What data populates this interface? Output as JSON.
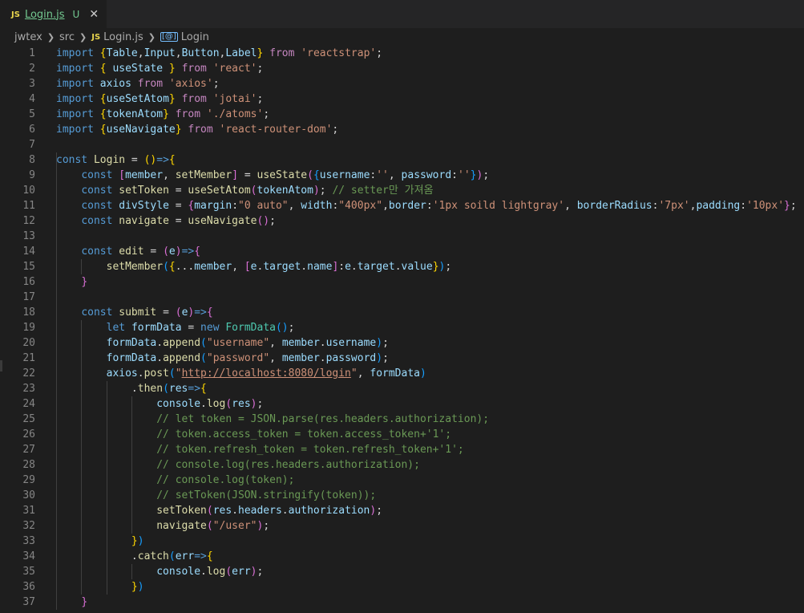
{
  "tab": {
    "badge": "JS",
    "filename": "Login.js",
    "status": "U",
    "close": "✕"
  },
  "breadcrumb": {
    "root": "jwtex",
    "folder": "src",
    "file_badge": "JS",
    "file": "Login.js",
    "symbol_icon": "[@]",
    "symbol": "Login"
  },
  "editor": {
    "lines": [
      [
        [
          "kw",
          "import"
        ],
        [
          "pun",
          " "
        ],
        [
          "br1",
          "{"
        ],
        [
          "var",
          "Table"
        ],
        [
          "pun",
          ","
        ],
        [
          "var",
          "Input"
        ],
        [
          "pun",
          ","
        ],
        [
          "var",
          "Button"
        ],
        [
          "pun",
          ","
        ],
        [
          "var",
          "Label"
        ],
        [
          "br1",
          "}"
        ],
        [
          "pun",
          " "
        ],
        [
          "ctrl",
          "from"
        ],
        [
          "pun",
          " "
        ],
        [
          "str",
          "'reactstrap'"
        ],
        [
          "pun",
          ";"
        ]
      ],
      [
        [
          "kw",
          "import"
        ],
        [
          "pun",
          " "
        ],
        [
          "br1",
          "{"
        ],
        [
          "pun",
          " "
        ],
        [
          "var",
          "useState"
        ],
        [
          "pun",
          " "
        ],
        [
          "br1",
          "}"
        ],
        [
          "pun",
          " "
        ],
        [
          "ctrl",
          "from"
        ],
        [
          "pun",
          " "
        ],
        [
          "str",
          "'react'"
        ],
        [
          "pun",
          ";"
        ]
      ],
      [
        [
          "kw",
          "import"
        ],
        [
          "pun",
          " "
        ],
        [
          "var",
          "axios"
        ],
        [
          "pun",
          " "
        ],
        [
          "ctrl",
          "from"
        ],
        [
          "pun",
          " "
        ],
        [
          "str",
          "'axios'"
        ],
        [
          "pun",
          ";"
        ]
      ],
      [
        [
          "kw",
          "import"
        ],
        [
          "pun",
          " "
        ],
        [
          "br1",
          "{"
        ],
        [
          "var",
          "useSetAtom"
        ],
        [
          "br1",
          "}"
        ],
        [
          "pun",
          " "
        ],
        [
          "ctrl",
          "from"
        ],
        [
          "pun",
          " "
        ],
        [
          "str",
          "'jotai'"
        ],
        [
          "pun",
          ";"
        ]
      ],
      [
        [
          "kw",
          "import"
        ],
        [
          "pun",
          " "
        ],
        [
          "br1",
          "{"
        ],
        [
          "var",
          "tokenAtom"
        ],
        [
          "br1",
          "}"
        ],
        [
          "pun",
          " "
        ],
        [
          "ctrl",
          "from"
        ],
        [
          "pun",
          " "
        ],
        [
          "str",
          "'./atoms'"
        ],
        [
          "pun",
          ";"
        ]
      ],
      [
        [
          "kw",
          "import"
        ],
        [
          "pun",
          " "
        ],
        [
          "br1",
          "{"
        ],
        [
          "var",
          "useNavigate"
        ],
        [
          "br1",
          "}"
        ],
        [
          "pun",
          " "
        ],
        [
          "ctrl",
          "from"
        ],
        [
          "pun",
          " "
        ],
        [
          "str",
          "'react-router-dom'"
        ],
        [
          "pun",
          ";"
        ]
      ],
      [],
      [
        [
          "kw",
          "const"
        ],
        [
          "pun",
          " "
        ],
        [
          "fn",
          "Login"
        ],
        [
          "pun",
          " = "
        ],
        [
          "br1",
          "()"
        ],
        [
          "kw",
          "=>"
        ],
        [
          "br1",
          "{"
        ]
      ],
      [
        [
          "pun",
          "    "
        ],
        [
          "kw",
          "const"
        ],
        [
          "pun",
          " "
        ],
        [
          "br2",
          "["
        ],
        [
          "var",
          "member"
        ],
        [
          "pun",
          ", "
        ],
        [
          "fn",
          "setMember"
        ],
        [
          "br2",
          "]"
        ],
        [
          "pun",
          " = "
        ],
        [
          "fn",
          "useState"
        ],
        [
          "br2",
          "("
        ],
        [
          "br3",
          "{"
        ],
        [
          "var",
          "username"
        ],
        [
          "pun",
          ":"
        ],
        [
          "str",
          "''"
        ],
        [
          "pun",
          ", "
        ],
        [
          "var",
          "password"
        ],
        [
          "pun",
          ":"
        ],
        [
          "str",
          "''"
        ],
        [
          "br3",
          "}"
        ],
        [
          "br2",
          ")"
        ],
        [
          "pun",
          ";"
        ]
      ],
      [
        [
          "pun",
          "    "
        ],
        [
          "kw",
          "const"
        ],
        [
          "pun",
          " "
        ],
        [
          "fn",
          "setToken"
        ],
        [
          "pun",
          " = "
        ],
        [
          "fn",
          "useSetAtom"
        ],
        [
          "br2",
          "("
        ],
        [
          "var",
          "tokenAtom"
        ],
        [
          "br2",
          ")"
        ],
        [
          "pun",
          "; "
        ],
        [
          "cmt",
          "// setter만 가져옴"
        ]
      ],
      [
        [
          "pun",
          "    "
        ],
        [
          "kw",
          "const"
        ],
        [
          "pun",
          " "
        ],
        [
          "var",
          "divStyle"
        ],
        [
          "pun",
          " = "
        ],
        [
          "br2",
          "{"
        ],
        [
          "var",
          "margin"
        ],
        [
          "pun",
          ":"
        ],
        [
          "str",
          "\"0 auto\""
        ],
        [
          "pun",
          ", "
        ],
        [
          "var",
          "width"
        ],
        [
          "pun",
          ":"
        ],
        [
          "str",
          "\"400px\""
        ],
        [
          "pun",
          ","
        ],
        [
          "var",
          "border"
        ],
        [
          "pun",
          ":"
        ],
        [
          "str",
          "'1px soild lightgray'"
        ],
        [
          "pun",
          ", "
        ],
        [
          "var",
          "borderRadius"
        ],
        [
          "pun",
          ":"
        ],
        [
          "str",
          "'7px'"
        ],
        [
          "pun",
          ","
        ],
        [
          "var",
          "padding"
        ],
        [
          "pun",
          ":"
        ],
        [
          "str",
          "'10px'"
        ],
        [
          "br2",
          "}"
        ],
        [
          "pun",
          ";"
        ]
      ],
      [
        [
          "pun",
          "    "
        ],
        [
          "kw",
          "const"
        ],
        [
          "pun",
          " "
        ],
        [
          "fn",
          "navigate"
        ],
        [
          "pun",
          " = "
        ],
        [
          "fn",
          "useNavigate"
        ],
        [
          "br2",
          "()"
        ],
        [
          "pun",
          ";"
        ]
      ],
      [],
      [
        [
          "pun",
          "    "
        ],
        [
          "kw",
          "const"
        ],
        [
          "pun",
          " "
        ],
        [
          "fn",
          "edit"
        ],
        [
          "pun",
          " = "
        ],
        [
          "br2",
          "("
        ],
        [
          "var",
          "e"
        ],
        [
          "br2",
          ")"
        ],
        [
          "kw",
          "=>"
        ],
        [
          "br2",
          "{"
        ]
      ],
      [
        [
          "pun",
          "        "
        ],
        [
          "fn",
          "setMember"
        ],
        [
          "br3",
          "("
        ],
        [
          "br1",
          "{"
        ],
        [
          "pun",
          "..."
        ],
        [
          "var",
          "member"
        ],
        [
          "pun",
          ", "
        ],
        [
          "br2",
          "["
        ],
        [
          "var",
          "e"
        ],
        [
          "pun",
          "."
        ],
        [
          "var",
          "target"
        ],
        [
          "pun",
          "."
        ],
        [
          "var",
          "name"
        ],
        [
          "br2",
          "]"
        ],
        [
          "pun",
          ":"
        ],
        [
          "var",
          "e"
        ],
        [
          "pun",
          "."
        ],
        [
          "var",
          "target"
        ],
        [
          "pun",
          "."
        ],
        [
          "var",
          "value"
        ],
        [
          "br1",
          "}"
        ],
        [
          "br3",
          ")"
        ],
        [
          "pun",
          ";"
        ]
      ],
      [
        [
          "pun",
          "    "
        ],
        [
          "br2",
          "}"
        ]
      ],
      [],
      [
        [
          "pun",
          "    "
        ],
        [
          "kw",
          "const"
        ],
        [
          "pun",
          " "
        ],
        [
          "fn",
          "submit"
        ],
        [
          "pun",
          " = "
        ],
        [
          "br2",
          "("
        ],
        [
          "var",
          "e"
        ],
        [
          "br2",
          ")"
        ],
        [
          "kw",
          "=>"
        ],
        [
          "br2",
          "{"
        ]
      ],
      [
        [
          "pun",
          "        "
        ],
        [
          "kw",
          "let"
        ],
        [
          "pun",
          " "
        ],
        [
          "var",
          "formData"
        ],
        [
          "pun",
          " = "
        ],
        [
          "kw",
          "new"
        ],
        [
          "pun",
          " "
        ],
        [
          "cls",
          "FormData"
        ],
        [
          "br3",
          "()"
        ],
        [
          "pun",
          ";"
        ]
      ],
      [
        [
          "pun",
          "        "
        ],
        [
          "var",
          "formData"
        ],
        [
          "pun",
          "."
        ],
        [
          "fn",
          "append"
        ],
        [
          "br3",
          "("
        ],
        [
          "str",
          "\"username\""
        ],
        [
          "pun",
          ", "
        ],
        [
          "var",
          "member"
        ],
        [
          "pun",
          "."
        ],
        [
          "var",
          "username"
        ],
        [
          "br3",
          ")"
        ],
        [
          "pun",
          ";"
        ]
      ],
      [
        [
          "pun",
          "        "
        ],
        [
          "var",
          "formData"
        ],
        [
          "pun",
          "."
        ],
        [
          "fn",
          "append"
        ],
        [
          "br3",
          "("
        ],
        [
          "str",
          "\"password\""
        ],
        [
          "pun",
          ", "
        ],
        [
          "var",
          "member"
        ],
        [
          "pun",
          "."
        ],
        [
          "var",
          "password"
        ],
        [
          "br3",
          ")"
        ],
        [
          "pun",
          ";"
        ]
      ],
      [
        [
          "pun",
          "        "
        ],
        [
          "var",
          "axios"
        ],
        [
          "pun",
          "."
        ],
        [
          "fn",
          "post"
        ],
        [
          "br3",
          "("
        ],
        [
          "str",
          "\""
        ],
        [
          "url",
          "http://localhost:8080/login"
        ],
        [
          "str",
          "\""
        ],
        [
          "pun",
          ", "
        ],
        [
          "var",
          "formData"
        ],
        [
          "br3",
          ")"
        ]
      ],
      [
        [
          "pun",
          "            ."
        ],
        [
          "fn",
          "then"
        ],
        [
          "br3",
          "("
        ],
        [
          "var",
          "res"
        ],
        [
          "kw",
          "=>"
        ],
        [
          "br1",
          "{"
        ]
      ],
      [
        [
          "pun",
          "                "
        ],
        [
          "var",
          "console"
        ],
        [
          "pun",
          "."
        ],
        [
          "fn",
          "log"
        ],
        [
          "br2",
          "("
        ],
        [
          "var",
          "res"
        ],
        [
          "br2",
          ")"
        ],
        [
          "pun",
          ";"
        ]
      ],
      [
        [
          "pun",
          "                "
        ],
        [
          "cmt",
          "// let token = JSON.parse(res.headers.authorization);"
        ]
      ],
      [
        [
          "pun",
          "                "
        ],
        [
          "cmt",
          "// token.access_token = token.access_token+'1';"
        ]
      ],
      [
        [
          "pun",
          "                "
        ],
        [
          "cmt",
          "// token.refresh_token = token.refresh_token+'1';"
        ]
      ],
      [
        [
          "pun",
          "                "
        ],
        [
          "cmt",
          "// console.log(res.headers.authorization);"
        ]
      ],
      [
        [
          "pun",
          "                "
        ],
        [
          "cmt",
          "// console.log(token);"
        ]
      ],
      [
        [
          "pun",
          "                "
        ],
        [
          "cmt",
          "// setToken(JSON.stringify(token));"
        ]
      ],
      [
        [
          "pun",
          "                "
        ],
        [
          "fn",
          "setToken"
        ],
        [
          "br2",
          "("
        ],
        [
          "var",
          "res"
        ],
        [
          "pun",
          "."
        ],
        [
          "var",
          "headers"
        ],
        [
          "pun",
          "."
        ],
        [
          "var",
          "authorization"
        ],
        [
          "br2",
          ")"
        ],
        [
          "pun",
          ";"
        ]
      ],
      [
        [
          "pun",
          "                "
        ],
        [
          "fn",
          "navigate"
        ],
        [
          "br2",
          "("
        ],
        [
          "str",
          "\"/user\""
        ],
        [
          "br2",
          ")"
        ],
        [
          "pun",
          ";"
        ]
      ],
      [
        [
          "pun",
          "            "
        ],
        [
          "br1",
          "}"
        ],
        [
          "br3",
          ")"
        ]
      ],
      [
        [
          "pun",
          "            ."
        ],
        [
          "fn",
          "catch"
        ],
        [
          "br3",
          "("
        ],
        [
          "var",
          "err"
        ],
        [
          "kw",
          "=>"
        ],
        [
          "br1",
          "{"
        ]
      ],
      [
        [
          "pun",
          "                "
        ],
        [
          "var",
          "console"
        ],
        [
          "pun",
          "."
        ],
        [
          "fn",
          "log"
        ],
        [
          "br2",
          "("
        ],
        [
          "var",
          "err"
        ],
        [
          "br2",
          ")"
        ],
        [
          "pun",
          ";"
        ]
      ],
      [
        [
          "pun",
          "            "
        ],
        [
          "br1",
          "}"
        ],
        [
          "br3",
          ")"
        ]
      ],
      [
        [
          "pun",
          "    "
        ],
        [
          "br2",
          "}"
        ]
      ]
    ]
  }
}
